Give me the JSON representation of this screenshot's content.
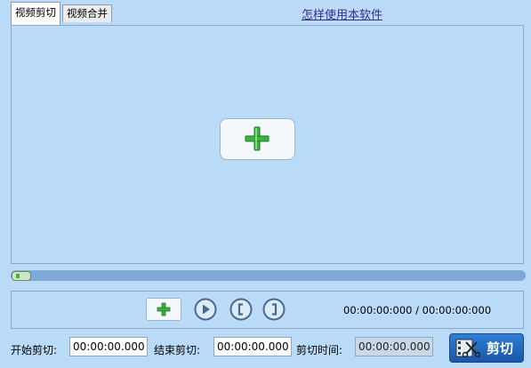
{
  "tabs": [
    {
      "label": "视频剪切"
    },
    {
      "label": "视频合并"
    }
  ],
  "help_link": "怎样使用本软件",
  "player": {
    "time_display": "00:00:00:000 / 00:00:00:000",
    "progress": 0
  },
  "fields": {
    "start_label": "开始剪切:",
    "start_value": "00:00:00.000",
    "end_label": "结束剪切:",
    "end_value": "00:00:00.000",
    "duration_label": "剪切时间:",
    "duration_value": "00:00:00.000"
  },
  "cut_button_label": "剪切",
  "icons": {
    "add": "plus-icon",
    "play": "play-icon",
    "mark_in": "bracket-left-icon",
    "mark_out": "bracket-right-icon",
    "cut": "film-scissors-icon"
  },
  "colors": {
    "background": "#b9dbf7",
    "accent_green": "#3cb043",
    "button_blue": "#1a56a8"
  }
}
